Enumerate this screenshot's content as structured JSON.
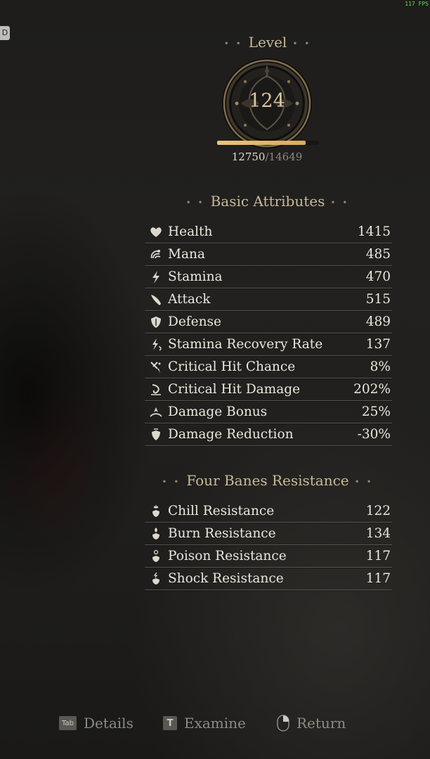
{
  "overlay": {
    "fps": "117 FPS",
    "corner_key": "D"
  },
  "level": {
    "title": "Level",
    "value": "124",
    "xp_current": "12750",
    "xp_separator": "/",
    "xp_max": "14649",
    "xp_progress": 0.87
  },
  "basic": {
    "title": "Basic Attributes",
    "items": [
      {
        "icon": "heart-icon",
        "label": "Health",
        "value": "1415"
      },
      {
        "icon": "mana-swirl-icon",
        "label": "Mana",
        "value": "485"
      },
      {
        "icon": "stamina-bolt-icon",
        "label": "Stamina",
        "value": "470"
      },
      {
        "icon": "blade-icon",
        "label": "Attack",
        "value": "515"
      },
      {
        "icon": "shield-icon",
        "label": "Defense",
        "value": "489"
      },
      {
        "icon": "stamina-recovery-icon",
        "label": "Stamina Recovery Rate",
        "value": "137"
      },
      {
        "icon": "crit-chance-icon",
        "label": "Critical Hit Chance",
        "value": "8%"
      },
      {
        "icon": "crit-damage-icon",
        "label": "Critical Hit Damage",
        "value": "202%"
      },
      {
        "icon": "damage-bonus-icon",
        "label": "Damage Bonus",
        "value": "25%"
      },
      {
        "icon": "damage-reduction-icon",
        "label": "Damage Reduction",
        "value": "-30%"
      }
    ]
  },
  "banes": {
    "title": "Four Banes Resistance",
    "items": [
      {
        "icon": "chill-icon",
        "label": "Chill Resistance",
        "value": "122"
      },
      {
        "icon": "burn-icon",
        "label": "Burn Resistance",
        "value": "134"
      },
      {
        "icon": "poison-icon",
        "label": "Poison Resistance",
        "value": "117"
      },
      {
        "icon": "shock-icon",
        "label": "Shock Resistance",
        "value": "117"
      }
    ]
  },
  "footer": {
    "details": {
      "key": "Tab",
      "label": "Details"
    },
    "examine": {
      "key": "T",
      "label": "Examine"
    },
    "return": {
      "label": "Return"
    }
  }
}
